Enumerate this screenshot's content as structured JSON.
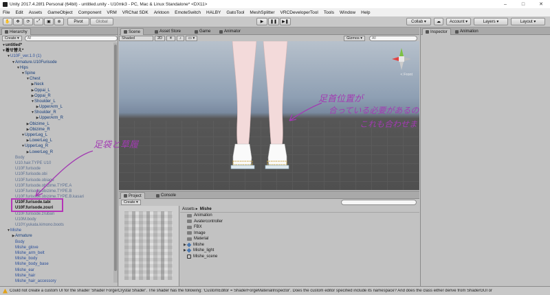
{
  "window": {
    "title": "Unity 2017.4.28f1 Personal (64bit) - untitled.unity - U10mk3 - PC, Mac & Linux Standalone* <DX11>",
    "min": "–",
    "max": "□",
    "close": "✕"
  },
  "menu": [
    "File",
    "Edit",
    "Assets",
    "GameObject",
    "Component",
    "VRM",
    "VRChat SDK",
    "Arktoon",
    "EmoteSwitch",
    "HALBY",
    "GatoTool",
    "MeshSplitter",
    "VRCDeveloperTool",
    "Tools",
    "Window",
    "Help"
  ],
  "toolbar": {
    "pivot": "Pivot",
    "global": "Global",
    "collab": "Collab ▾",
    "account": "Account",
    "layers": "Layers",
    "layout": "Layout",
    "cloud_icon": "cloud-icon"
  },
  "hierarchy": {
    "tab": "Hierarchy",
    "create": "Create ▾",
    "search_placeholder": "All",
    "rows": [
      {
        "label": "untitled*",
        "depth": 0,
        "tri": "▼",
        "style": "bold"
      },
      {
        "label": "着せ替え*",
        "depth": 0,
        "tri": "▼",
        "style": "bold"
      },
      {
        "label": "U10F_ver.1.0 (1)",
        "depth": 1,
        "tri": "▼",
        "style": "blue"
      },
      {
        "label": "Armature.U10Furisode",
        "depth": 2,
        "tri": "▼",
        "style": "normal"
      },
      {
        "label": "Hips",
        "depth": 3,
        "tri": "▼",
        "style": "normal"
      },
      {
        "label": "Spine",
        "depth": 4,
        "tri": "▼",
        "style": "normal"
      },
      {
        "label": "Chest",
        "depth": 5,
        "tri": "▼",
        "style": "normal"
      },
      {
        "label": "Neck",
        "depth": 6,
        "tri": "▶",
        "style": "normal"
      },
      {
        "label": "Oppai_L",
        "depth": 6,
        "tri": "▶",
        "style": "normal"
      },
      {
        "label": "Oppai_R",
        "depth": 6,
        "tri": "▶",
        "style": "normal"
      },
      {
        "label": "Shoulder_L",
        "depth": 6,
        "tri": "▼",
        "style": "normal"
      },
      {
        "label": "UpperArm_L",
        "depth": 7,
        "tri": "▶",
        "style": "normal"
      },
      {
        "label": "Shoulder_R",
        "depth": 6,
        "tri": "▼",
        "style": "normal"
      },
      {
        "label": "UpperArm_R",
        "depth": 7,
        "tri": "▶",
        "style": "normal"
      },
      {
        "label": "Obizime_L",
        "depth": 5,
        "tri": "▶",
        "style": "normal"
      },
      {
        "label": "Obizime_R",
        "depth": 5,
        "tri": "▶",
        "style": "normal"
      },
      {
        "label": "UpperLeg_L",
        "depth": 4,
        "tri": "▼",
        "style": "normal"
      },
      {
        "label": "LowerLeg_L",
        "depth": 5,
        "tri": "▶",
        "style": "normal"
      },
      {
        "label": "UpperLeg_R",
        "depth": 4,
        "tri": "▼",
        "style": "normal"
      },
      {
        "label": "LowerLeg_R",
        "depth": 5,
        "tri": "▶",
        "style": "normal"
      },
      {
        "label": "Body",
        "depth": 2,
        "tri": "",
        "style": "gray"
      },
      {
        "label": "U10.hair.TYPE U10",
        "depth": 2,
        "tri": "",
        "style": "gray"
      },
      {
        "label": "U10F.furisode",
        "depth": 2,
        "tri": "",
        "style": "gray"
      },
      {
        "label": "U10F.furisode.obi",
        "depth": 2,
        "tri": "",
        "style": "gray"
      },
      {
        "label": "U10F.furisode.obiage",
        "depth": 2,
        "tri": "",
        "style": "gray"
      },
      {
        "label": "U10F.furisode.obizime.TYPE.A",
        "depth": 2,
        "tri": "",
        "style": "gray"
      },
      {
        "label": "U10F.furisode.obizime.TYPE.B",
        "depth": 2,
        "tri": "",
        "style": "gray"
      },
      {
        "label": "U10F.furisode.obizime.TYPE.B.kasari",
        "depth": 2,
        "tri": "",
        "style": "gray"
      },
      {
        "label": "U10F.furisode.tabi",
        "depth": 2,
        "tri": "",
        "style": "bold"
      },
      {
        "label": "U10F.furisode.zouri",
        "depth": 2,
        "tri": "",
        "style": "bold"
      },
      {
        "label": "U10F.furisode.zrubari",
        "depth": 2,
        "tri": "",
        "style": "gray"
      },
      {
        "label": "U10M.body",
        "depth": 2,
        "tri": "",
        "style": "gray"
      },
      {
        "label": "U10Y.yukata.kimono.boots",
        "depth": 2,
        "tri": "",
        "style": "gray"
      },
      {
        "label": "Mishe",
        "depth": 1,
        "tri": "▼",
        "style": "blue"
      },
      {
        "label": "Armature",
        "depth": 2,
        "tri": "▶",
        "style": "normal"
      },
      {
        "label": "Body",
        "depth": 2,
        "tri": "",
        "style": "blue"
      },
      {
        "label": "Mishe_glove",
        "depth": 2,
        "tri": "",
        "style": "blue"
      },
      {
        "label": "Mishe_arm_belt",
        "depth": 2,
        "tri": "",
        "style": "blue"
      },
      {
        "label": "Mishe_body",
        "depth": 2,
        "tri": "",
        "style": "blue"
      },
      {
        "label": "Mishe_body_base",
        "depth": 2,
        "tri": "",
        "style": "blue"
      },
      {
        "label": "Mishe_ear",
        "depth": 2,
        "tri": "",
        "style": "blue"
      },
      {
        "label": "Mishe_hair",
        "depth": 2,
        "tri": "",
        "style": "blue"
      },
      {
        "label": "Mishe_hair_accessory",
        "depth": 2,
        "tri": "",
        "style": "blue"
      }
    ]
  },
  "scene": {
    "tabs": [
      "Scene",
      "Asset Store",
      "Game",
      "Animator"
    ],
    "shaded": "Shaded",
    "mode2d": "2D",
    "gizmos": "Gizmos ▾",
    "search_placeholder": "All",
    "front_label": "< Front"
  },
  "inspector": {
    "tabs": [
      "Inspector",
      "Animation"
    ]
  },
  "project": {
    "tabs": [
      "Project",
      "Console"
    ],
    "create": "Create ▾",
    "breadcrumb": [
      "Assets ▸",
      "Mishe"
    ],
    "assets": [
      {
        "label": "Animation",
        "kind": "folder",
        "tri": ""
      },
      {
        "label": "Avatercontroller",
        "kind": "folder",
        "tri": ""
      },
      {
        "label": "FBX",
        "kind": "folder",
        "tri": ""
      },
      {
        "label": "Image",
        "kind": "folder",
        "tri": ""
      },
      {
        "label": "Material",
        "kind": "folder",
        "tri": ""
      },
      {
        "label": "Mishe",
        "kind": "model",
        "tri": "▶"
      },
      {
        "label": "Mishe_light",
        "kind": "model",
        "tri": "▶"
      },
      {
        "label": "Mishe_scene",
        "kind": "unity",
        "tri": ""
      }
    ]
  },
  "annotations": {
    "feet_line1": "足首位置が",
    "feet_line2": "合っている必要があるので",
    "feet_line3": "これも合わせます。",
    "tabi_zouri": "足袋と草履"
  },
  "status": "Could not create a custom UI for the shader 'Shader Forge/Crystal Shader'. The shader has the following: 'CustomEditor = ShaderForgeMaterialInspector'. Does the custom editor specified include its namespace? And does the class either derive from ShaderGUI or",
  "colors": {
    "annotation": "#a23bb2",
    "sky": "#8e9fb3",
    "ground": "#505050"
  }
}
